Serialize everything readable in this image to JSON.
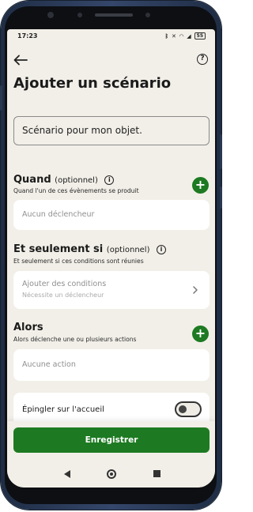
{
  "status_bar": {
    "time": "17:23",
    "icons": [
      "bluetooth-icon",
      "mute-icon",
      "wifi-icon",
      "signal-icon"
    ],
    "battery": "55"
  },
  "header": {
    "back_icon": "arrow-left-icon",
    "help_icon": "help-circle-icon",
    "help_glyph": "?",
    "title": "Ajouter un scénario"
  },
  "scenario_name": {
    "value": "Scénario pour mon objet."
  },
  "when": {
    "title": "Quand",
    "optional": "(optionnel)",
    "info_glyph": "i",
    "subtitle": "Quand l'un de ces évènements se produit",
    "add_glyph": "+",
    "placeholder": "Aucun déclencheur"
  },
  "only_if": {
    "title": "Et seulement si",
    "optional": "(optionnel)",
    "info_glyph": "i",
    "subtitle": "Et seulement si ces conditions sont réunies",
    "card_title": "Ajouter des conditions",
    "card_sub": "Nécessite un déclencheur"
  },
  "then": {
    "title": "Alors",
    "subtitle": "Alors déclenche une ou plusieurs actions",
    "add_glyph": "+",
    "placeholder": "Aucune action"
  },
  "pin": {
    "label": "Épingler sur l'accueil",
    "enabled": false
  },
  "footer": {
    "save_label": "Enregistrer"
  },
  "colors": {
    "accent": "#1d7a22",
    "background": "#f2efe8",
    "card": "#ffffff"
  }
}
